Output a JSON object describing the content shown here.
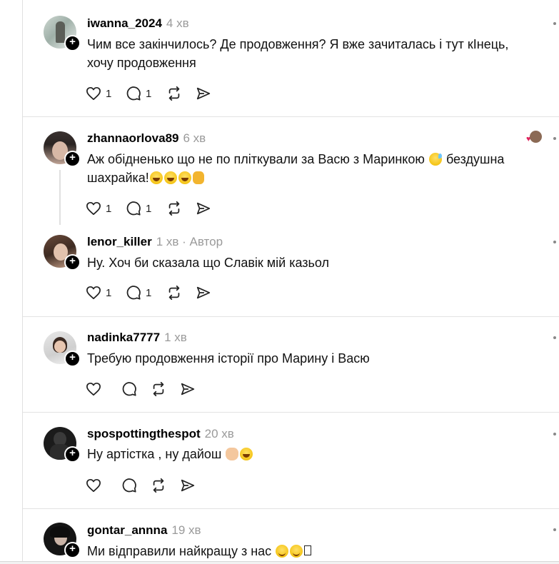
{
  "posts": [
    {
      "username": "iwanna_2024",
      "time": "4 хв",
      "text": "Чим все закінчилось? Де продовження? Я вже зачиталась і тут кІнець, хочу продовження",
      "likes": "1",
      "replies": "1"
    },
    {
      "username": "zhannaorlova89",
      "time": "6 хв",
      "text_before": "Аж обідненько що не по пліткували за Васю з Маринкою",
      "text_after": "бездушна шахрайка!",
      "likes": "1",
      "replies": "1"
    },
    {
      "username": "lenor_killer",
      "time": "1 хв",
      "author_tag": "· Автор",
      "text": "Ну. Хоч би сказала що Славік мій казьол",
      "likes": "1",
      "replies": "1"
    },
    {
      "username": "nadinka7777",
      "time": "1 хв",
      "text": "Требую продовження історії про Марину і Васю"
    },
    {
      "username": "spospottingthespot",
      "time": "20 хв",
      "text": "Ну артістка , ну дайош"
    },
    {
      "username": "gontar_annna",
      "time": "19 хв",
      "text": "Ми відправили найкращу з нас"
    }
  ],
  "icons": {
    "like": "heart-icon",
    "reply": "comment-icon",
    "repost": "repost-icon",
    "share": "send-icon",
    "follow": "plus-icon",
    "more": "more-dots-icon"
  },
  "colors": {
    "text": "#111111",
    "muted": "#9a9a9a",
    "divider": "#e3e3e3",
    "follow_badge": "#000000"
  }
}
